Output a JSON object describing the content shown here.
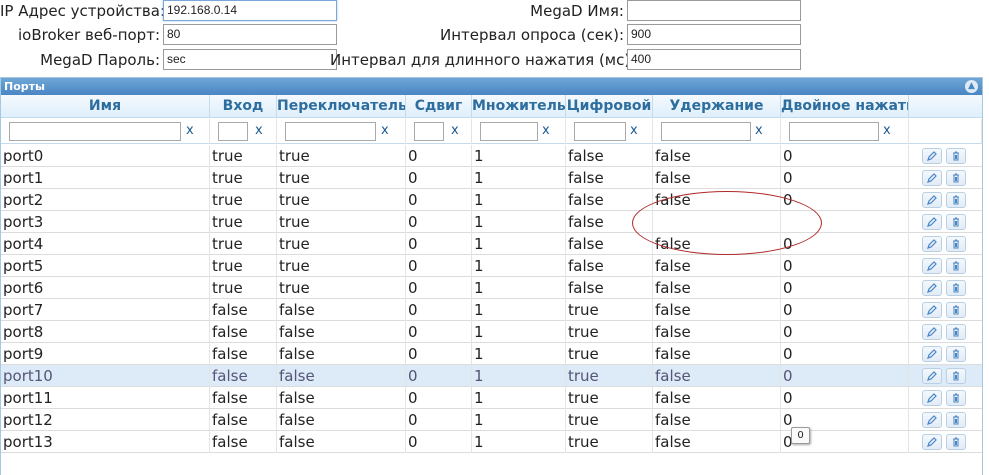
{
  "form": {
    "ip_label": "IP Адрес устройства:",
    "ip_value": "192.168.0.14",
    "name_label": "MegaD Имя:",
    "name_value": "",
    "port_label": "ioBroker веб-порт:",
    "port_value": "80",
    "poll_label": "Интервал опроса (сек):",
    "poll_value": "900",
    "pass_label": "MegaD Пароль:",
    "pass_value": "sec",
    "long_label": "Интервал для длинного нажатия (мс):",
    "long_value": "400"
  },
  "grid": {
    "caption": "Порты",
    "headers": [
      "Имя",
      "Вход",
      "Переключатель",
      "Сдвиг",
      "Множитель",
      "Цифровой",
      "Удержание",
      "Двойное нажатие"
    ],
    "filter_clear": "x",
    "rows": [
      [
        "port0",
        "true",
        "true",
        "0",
        "1",
        "false",
        "false",
        "0"
      ],
      [
        "port1",
        "true",
        "true",
        "0",
        "1",
        "false",
        "false",
        "0"
      ],
      [
        "port2",
        "true",
        "true",
        "0",
        "1",
        "false",
        "false",
        "0"
      ],
      [
        "port3",
        "true",
        "true",
        "0",
        "1",
        "false",
        "",
        ""
      ],
      [
        "port4",
        "true",
        "true",
        "0",
        "1",
        "false",
        "false",
        "0"
      ],
      [
        "port5",
        "true",
        "true",
        "0",
        "1",
        "false",
        "false",
        "0"
      ],
      [
        "port6",
        "true",
        "true",
        "0",
        "1",
        "false",
        "false",
        "0"
      ],
      [
        "port7",
        "false",
        "false",
        "0",
        "1",
        "true",
        "false",
        "0"
      ],
      [
        "port8",
        "false",
        "false",
        "0",
        "1",
        "true",
        "false",
        "0"
      ],
      [
        "port9",
        "false",
        "false",
        "0",
        "1",
        "true",
        "false",
        "0"
      ],
      [
        "port10",
        "false",
        "false",
        "0",
        "1",
        "true",
        "false",
        "0"
      ],
      [
        "port11",
        "false",
        "false",
        "0",
        "1",
        "true",
        "false",
        "0"
      ],
      [
        "port12",
        "false",
        "false",
        "0",
        "1",
        "true",
        "false",
        "0"
      ],
      [
        "port13",
        "false",
        "false",
        "0",
        "1",
        "true",
        "false",
        "0"
      ]
    ],
    "selected_row": 10,
    "tooltip": "0"
  }
}
